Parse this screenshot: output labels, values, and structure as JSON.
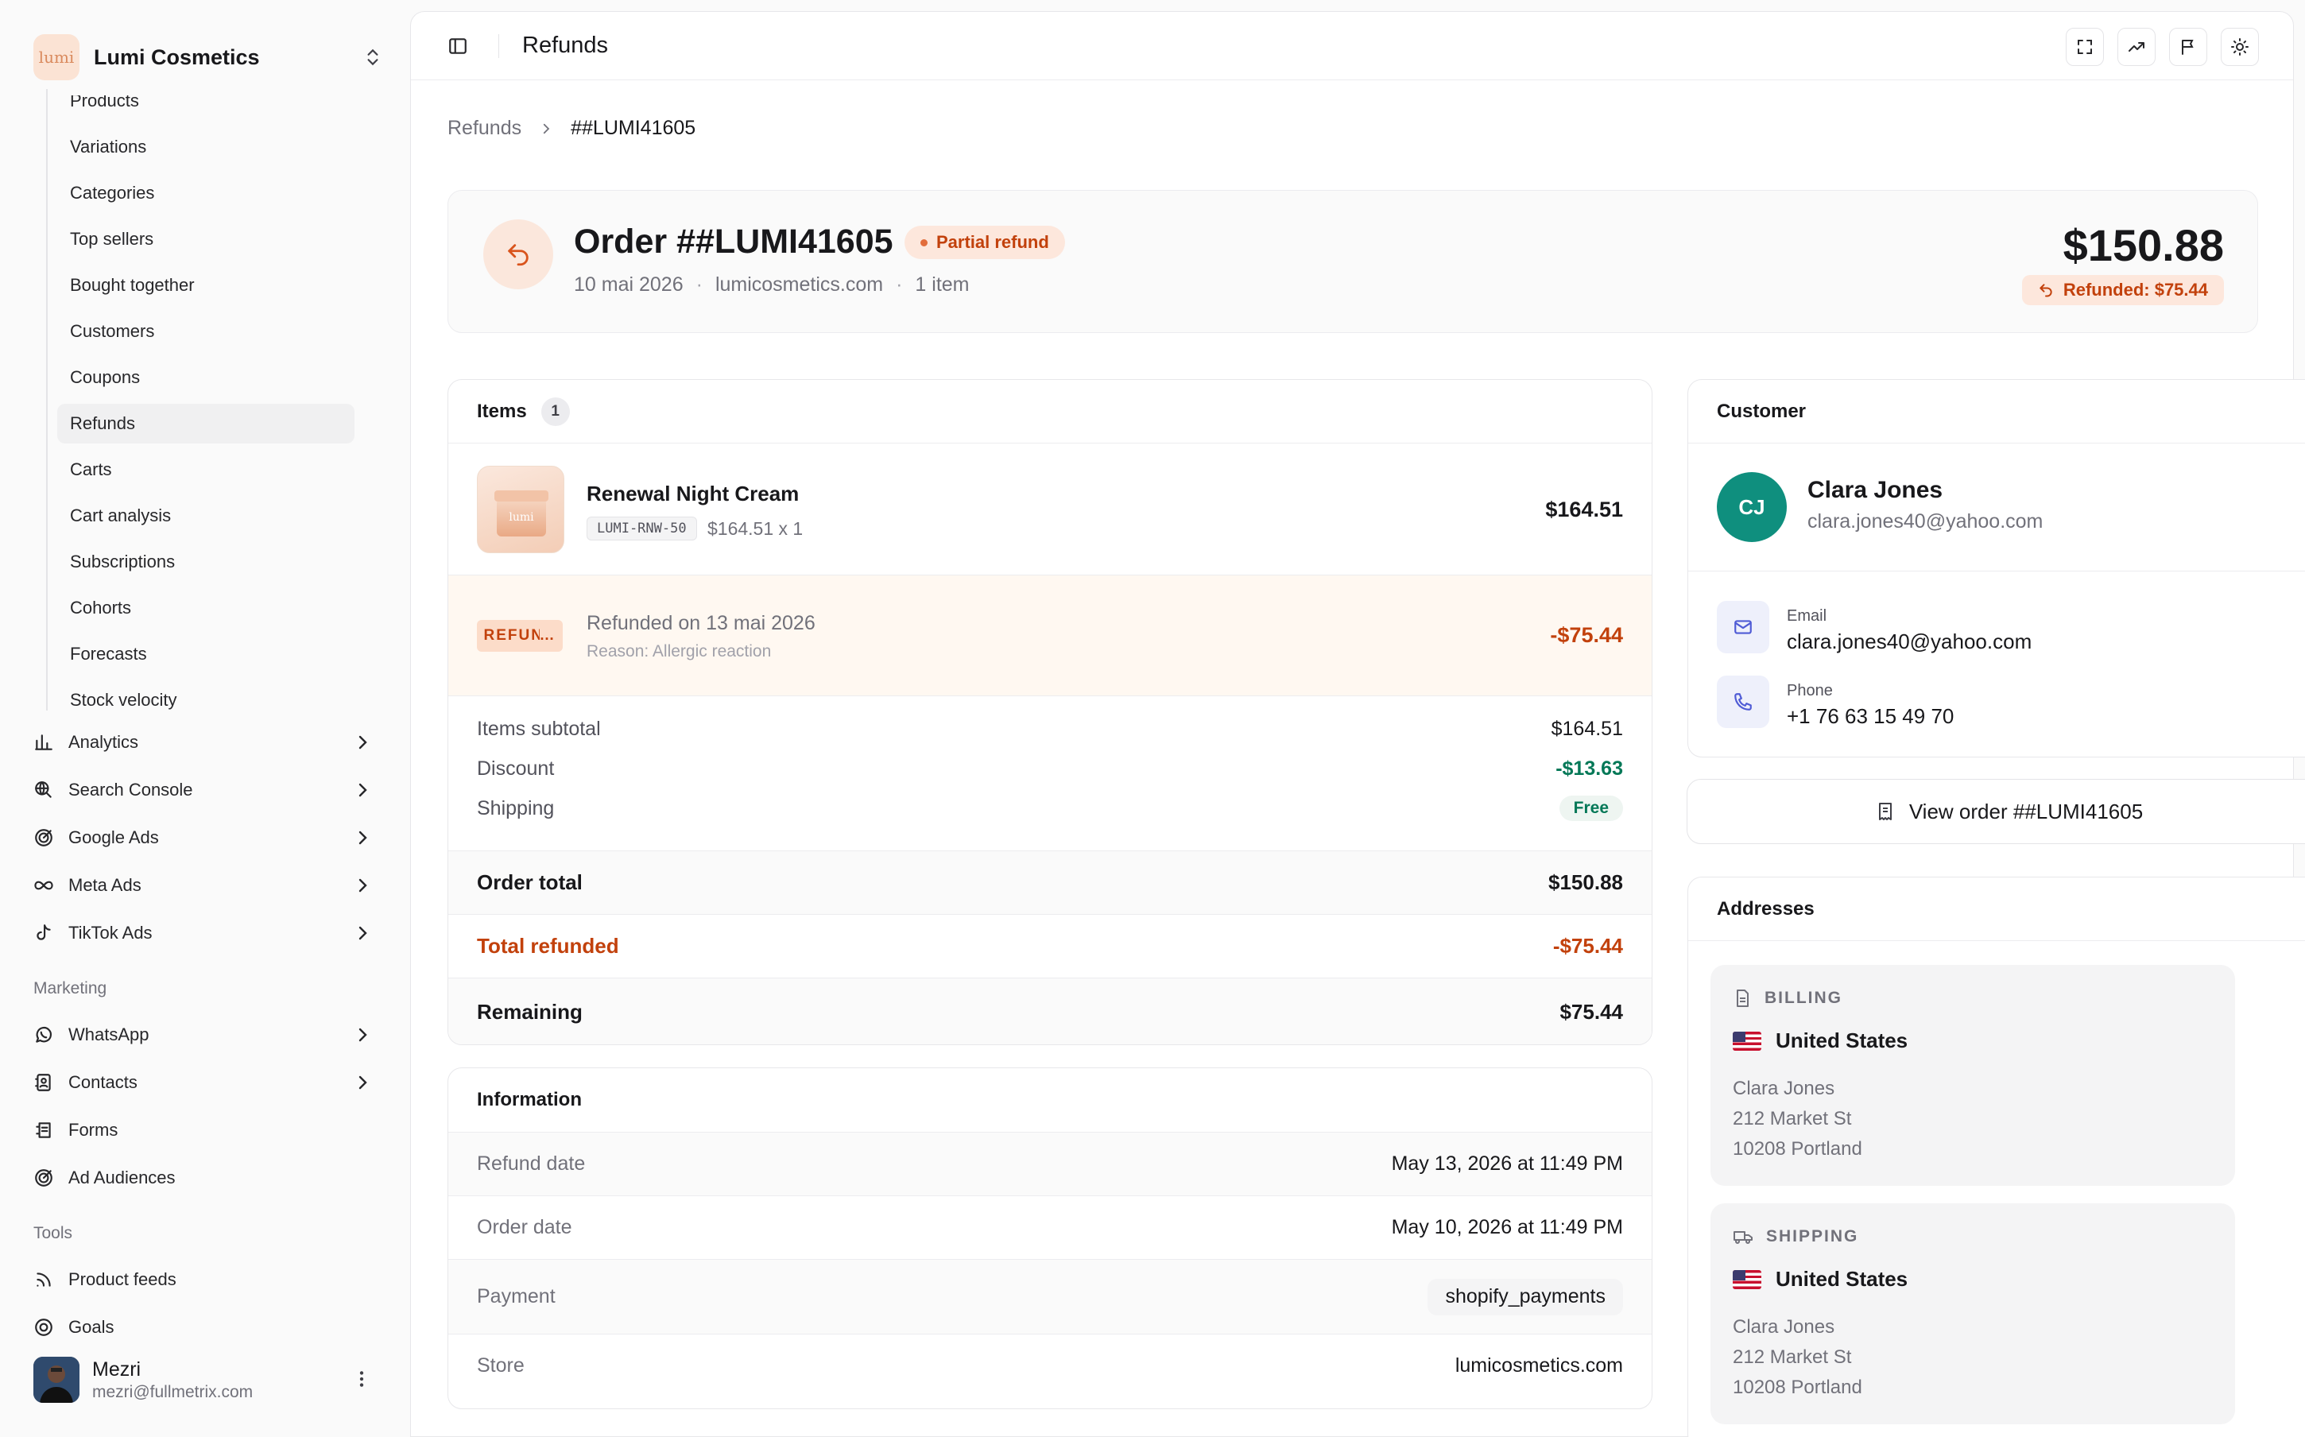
{
  "brand": {
    "name": "Lumi Cosmetics",
    "logo_text": "lumi"
  },
  "sidebar": {
    "sub_items": [
      {
        "label": "Products",
        "name": "sidebar-item-products"
      },
      {
        "label": "Variations",
        "name": "sidebar-item-variations"
      },
      {
        "label": "Categories",
        "name": "sidebar-item-categories"
      },
      {
        "label": "Top sellers",
        "name": "sidebar-item-top-sellers"
      },
      {
        "label": "Bought together",
        "name": "sidebar-item-bought-together"
      },
      {
        "label": "Customers",
        "name": "sidebar-item-customers"
      },
      {
        "label": "Coupons",
        "name": "sidebar-item-coupons"
      },
      {
        "label": "Refunds",
        "name": "sidebar-item-refunds",
        "active": true
      },
      {
        "label": "Carts",
        "name": "sidebar-item-carts"
      },
      {
        "label": "Cart analysis",
        "name": "sidebar-item-cart-analysis"
      },
      {
        "label": "Subscriptions",
        "name": "sidebar-item-subscriptions"
      },
      {
        "label": "Cohorts",
        "name": "sidebar-item-cohorts"
      },
      {
        "label": "Forecasts",
        "name": "sidebar-item-forecasts"
      },
      {
        "label": "Stock velocity",
        "name": "sidebar-item-stock-velocity"
      }
    ],
    "groups": [
      {
        "label": "Analytics",
        "icon": "bar-chart-icon"
      },
      {
        "label": "Search Console",
        "icon": "globe-search-icon"
      },
      {
        "label": "Google Ads",
        "icon": "target-icon"
      },
      {
        "label": "Meta Ads",
        "icon": "infinity-icon"
      },
      {
        "label": "TikTok Ads",
        "icon": "tiktok-icon"
      }
    ],
    "marketing_label": "Marketing",
    "marketing": [
      {
        "label": "WhatsApp",
        "icon": "whatsapp-icon"
      },
      {
        "label": "Contacts",
        "icon": "contacts-icon"
      },
      {
        "label": "Forms",
        "icon": "forms-icon"
      },
      {
        "label": "Ad Audiences",
        "icon": "target-icon"
      }
    ],
    "tools_label": "Tools",
    "tools": [
      {
        "label": "Product feeds",
        "icon": "rss-icon"
      },
      {
        "label": "Goals",
        "icon": "goal-icon"
      }
    ],
    "user": {
      "name": "Mezri",
      "email": "mezri@fullmetrix.com"
    }
  },
  "topbar": {
    "title": "Refunds"
  },
  "breadcrumb": {
    "parent": "Refunds",
    "current": "##LUMI41605"
  },
  "order": {
    "title": "Order ##LUMI41605",
    "status": "Partial refund",
    "date": "10 mai 2026",
    "store": "lumicosmetics.com",
    "items_count": "1 item",
    "total": "$150.88",
    "refunded_badge": "Refunded: $75.44"
  },
  "items_card": {
    "title": "Items",
    "count": "1",
    "item": {
      "name": "Renewal Night Cream",
      "sku": "LUMI-RNW-50",
      "qty": "$164.51 x 1",
      "price": "$164.51",
      "thumb_text": "lumi"
    },
    "refund": {
      "chip": "REFUNDED",
      "date": "Refunded on 13 mai 2026",
      "reason": "Reason: Allergic reaction",
      "amount": "-$75.44"
    },
    "summary": {
      "subtotal_label": "Items subtotal",
      "subtotal": "$164.51",
      "discount_label": "Discount",
      "discount": "-$13.63",
      "shipping_label": "Shipping",
      "shipping": "Free",
      "order_total_label": "Order total",
      "order_total": "$150.88",
      "refunded_label": "Total refunded",
      "refunded": "-$75.44",
      "remaining_label": "Remaining",
      "remaining": "$75.44"
    }
  },
  "information": {
    "title": "Information",
    "refund_date_label": "Refund date",
    "refund_date": "May 13, 2026 at 11:49 PM",
    "order_date_label": "Order date",
    "order_date": "May 10, 2026 at 11:49 PM",
    "payment_label": "Payment",
    "payment": "shopify_payments",
    "store_label": "Store",
    "store": "lumicosmetics.com"
  },
  "customer": {
    "title": "Customer",
    "initials": "CJ",
    "name": "Clara Jones",
    "email": "clara.jones40@yahoo.com",
    "email_label": "Email",
    "phone_label": "Phone",
    "phone": "+1 76 63 15 49 70",
    "avatar_color": "#0f8f7e"
  },
  "view_order": "View order ##LUMI41605",
  "addresses": {
    "title": "Addresses",
    "billing": {
      "label": "BILLING",
      "country": "United States",
      "name": "Clara Jones",
      "street": "212 Market St",
      "city": "10208 Portland"
    },
    "shipping": {
      "label": "SHIPPING",
      "country": "United States",
      "name": "Clara Jones",
      "street": "212 Market St",
      "city": "10208 Portland"
    }
  },
  "colors": {
    "accent": "#c2410c",
    "success": "#047857"
  }
}
